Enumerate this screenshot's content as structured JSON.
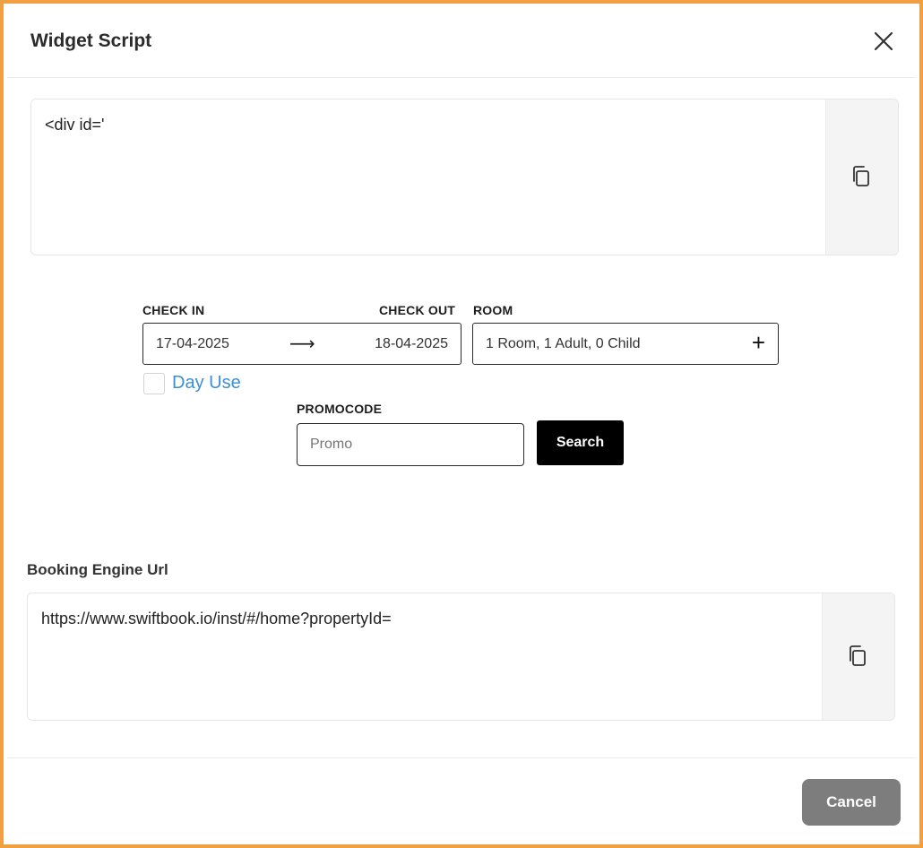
{
  "dialog": {
    "title": "Widget Script",
    "close_icon": "close-icon"
  },
  "script_box": {
    "code": "<div id='",
    "copy_icon": "copy-icon"
  },
  "widget": {
    "check_in_label": "CHECK IN",
    "check_out_label": "CHECK OUT",
    "room_label": "ROOM",
    "check_in_value": "17-04-2025",
    "arrow": "⟶",
    "check_out_value": "18-04-2025",
    "room_value": "1 Room, 1 Adult, 0 Child",
    "room_add": "+",
    "day_use_label": "Day Use",
    "promocode_label": "PROMOCODE",
    "promo_placeholder": "Promo",
    "search_label": "Search"
  },
  "booking_url": {
    "label": "Booking Engine Url",
    "value": "https://www.swiftbook.io/inst/#/home?propertyId=",
    "copy_icon": "copy-icon"
  },
  "footer": {
    "cancel_label": "Cancel"
  },
  "colors": {
    "frame_border": "#f0a040",
    "link_blue": "#3a8fd9",
    "search_bg": "#000000",
    "cancel_bg": "#7d7d7d"
  }
}
